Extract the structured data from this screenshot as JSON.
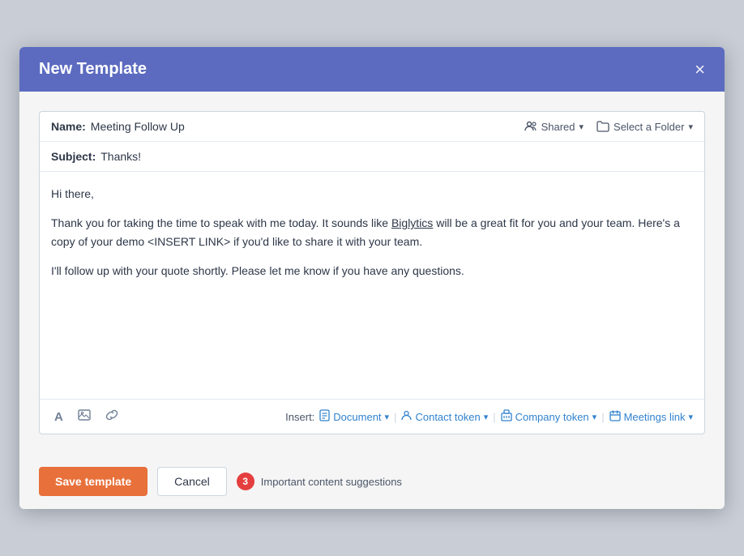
{
  "modal": {
    "title": "New Template",
    "close_label": "×"
  },
  "name_row": {
    "label": "Name:",
    "value": "Meeting Follow Up",
    "shared_label": "Shared",
    "folder_label": "Select a Folder"
  },
  "subject_row": {
    "label": "Subject:",
    "value": "Thanks!"
  },
  "body": {
    "line1": "Hi there,",
    "line2": "Thank you for taking the time to speak with me today. It sounds like Biglytics will be a great fit for you and your team. Here's a copy of your demo <INSERT LINK> if you'd like to share it with your team.",
    "line3": "I'll follow up with your quote shortly. Please let me know if you have any questions."
  },
  "toolbar": {
    "insert_label": "Insert:",
    "document_label": "Document",
    "contact_token_label": "Contact token",
    "company_token_label": "Company token",
    "meetings_link_label": "Meetings link"
  },
  "footer": {
    "save_label": "Save template",
    "cancel_label": "Cancel",
    "badge_count": "3",
    "suggestions_label": "Important content suggestions"
  },
  "icons": {
    "close": "✕",
    "font": "A",
    "image": "🖼",
    "link": "🔗",
    "people": "👥",
    "folder": "🗂",
    "document": "📄",
    "person": "👤",
    "building": "🏢",
    "calendar": "📅",
    "chevron": "▾"
  }
}
